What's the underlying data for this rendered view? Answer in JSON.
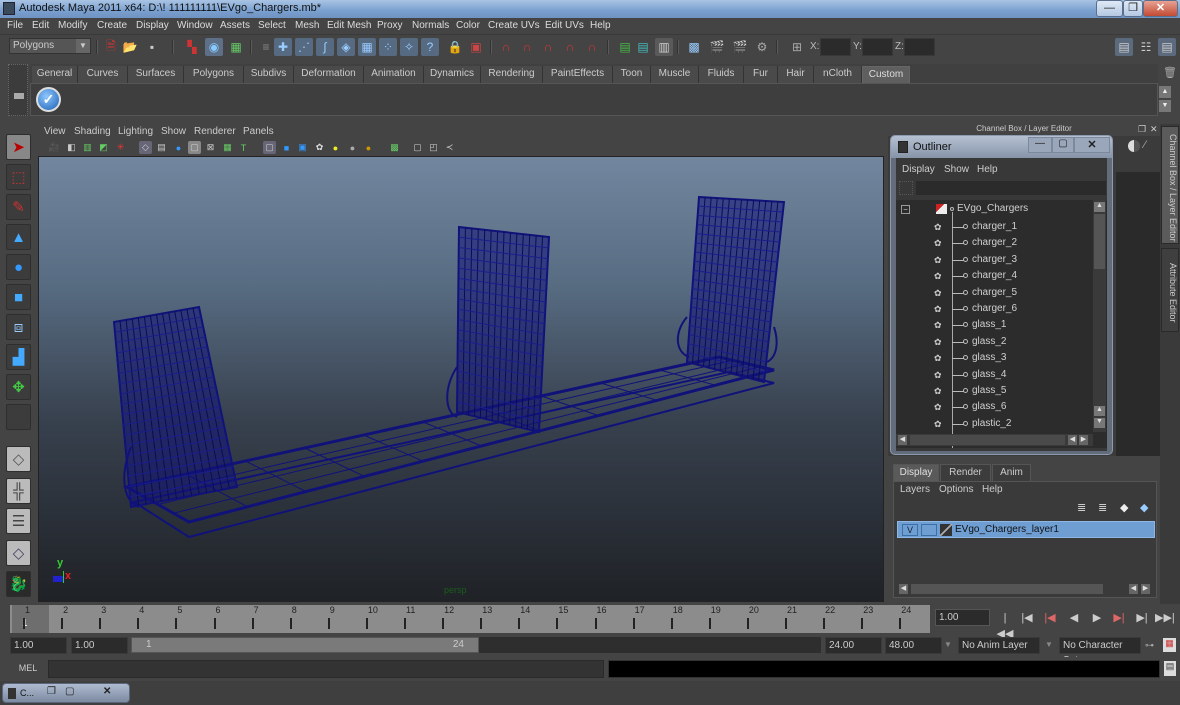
{
  "window": {
    "title": "Autodesk Maya 2011 x64: D:\\! 111111111\\EVgo_Chargers.mb*",
    "minimize": "—",
    "maximize": "❐",
    "close": "✕"
  },
  "menubar": [
    "File",
    "Edit",
    "Modify",
    "Create",
    "Display",
    "Window",
    "Assets",
    "Select",
    "Mesh",
    "Edit Mesh",
    "Proxy",
    "Normals",
    "Color",
    "Create UVs",
    "Edit UVs",
    "Help"
  ],
  "statusline": {
    "menu_set": "Polygons",
    "x_label": "X:",
    "y_label": "Y:",
    "z_label": "Z:",
    "x_value": "",
    "y_value": "",
    "z_value": ""
  },
  "shelf": {
    "tabs": [
      "General",
      "Curves",
      "Surfaces",
      "Polygons",
      "Subdivs",
      "Deformation",
      "Animation",
      "Dynamics",
      "Rendering",
      "PaintEffects",
      "Toon",
      "Muscle",
      "Fluids",
      "Fur",
      "Hair",
      "nCloth",
      "Custom"
    ],
    "active_tab": "Custom"
  },
  "viewport": {
    "menus": [
      "View",
      "Shading",
      "Lighting",
      "Show",
      "Renderer",
      "Panels"
    ],
    "camera_label": "persp",
    "axis": {
      "y": "y",
      "x": "x"
    },
    "wire_color": "#10127a"
  },
  "channel_box": {
    "title": "Channel Box / Layer Editor",
    "side_tabs": [
      "Channel Box / Layer Editor",
      "Attribute Editor"
    ]
  },
  "outliner": {
    "title": "Outliner",
    "menus": [
      "Display",
      "Show",
      "Help"
    ],
    "filter_value": "",
    "root": "EVgo_Chargers",
    "items": [
      "charger_1",
      "charger_2",
      "charger_3",
      "charger_4",
      "charger_5",
      "charger_6",
      "glass_1",
      "glass_2",
      "glass_3",
      "glass_4",
      "glass_5",
      "glass_6",
      "plastic_2"
    ]
  },
  "layer_editor": {
    "tabs": [
      "Display",
      "Render",
      "Anim"
    ],
    "active_tab": "Display",
    "menus": [
      "Layers",
      "Options",
      "Help"
    ],
    "layers": [
      {
        "visible": "V",
        "name": "EVgo_Chargers_layer1"
      }
    ]
  },
  "timeline": {
    "ticks": [
      "1",
      "2",
      "3",
      "4",
      "5",
      "6",
      "7",
      "8",
      "9",
      "10",
      "11",
      "12",
      "13",
      "14",
      "15",
      "16",
      "17",
      "18",
      "19",
      "20",
      "21",
      "22",
      "23",
      "24"
    ],
    "current_marker": "1",
    "current_frame": "1.00",
    "playback": [
      "|◀◀",
      "|◀",
      "|◀",
      "◀",
      "▶",
      "▶|",
      "▶|",
      "▶▶|"
    ]
  },
  "range": {
    "start_time": "1.00",
    "playback_start": "1.00",
    "range_start_label": "1",
    "range_end_label": "24",
    "playback_end": "24.00",
    "end_time": "48.00",
    "anim_layer": "No Anim Layer",
    "character_set": "No Character Set"
  },
  "command_line": {
    "label": "MEL",
    "input": "",
    "output": ""
  },
  "minimized_window": {
    "label": "C..."
  }
}
